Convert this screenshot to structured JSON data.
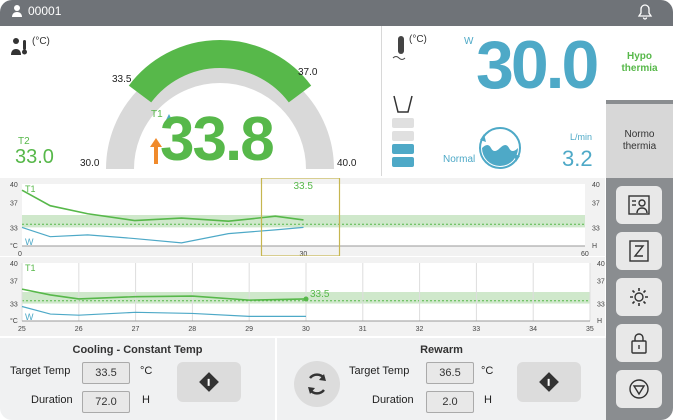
{
  "topbar": {
    "patient_id": "00001",
    "icons": [
      "person-icon",
      "bell-icon"
    ]
  },
  "left_panel": {
    "unit": "(°C)",
    "gauge": {
      "min_label": "30.0",
      "max_label": "40.0",
      "low_limit_label": "33.5",
      "high_limit_label": "37.0",
      "t1_label": "T1",
      "t1_value": "33.8",
      "t2_label": "T2",
      "t2_value": "33.0"
    }
  },
  "right_panel": {
    "unit": "(°C)",
    "w_label": "W",
    "w_value": "30.0",
    "flow_label": "Normal",
    "flow_unit": "L/min",
    "flow_value": "3.2"
  },
  "modes": {
    "hypothermia": "Hypo\nthermia",
    "normothermia": "Normo\nthermia"
  },
  "chart1": {
    "y_ticks_left": [
      "40",
      "37",
      "33",
      "°C"
    ],
    "y_ticks_right": [
      "40",
      "37",
      "33",
      "H"
    ],
    "x_ticks": [
      "0",
      "30",
      "60"
    ],
    "highlight_value": "33.5",
    "t1_label": "T1",
    "w_label": "W"
  },
  "chart2": {
    "y_ticks_left": [
      "40",
      "37",
      "33",
      "°C"
    ],
    "y_ticks_right": [
      "40",
      "37",
      "33",
      "H"
    ],
    "x_ticks": [
      "25",
      "26",
      "27",
      "28",
      "29",
      "30",
      "31",
      "32",
      "33",
      "34",
      "35"
    ],
    "marker_value": "33.5",
    "t1_label": "T1",
    "w_label": "W"
  },
  "chart_data": [
    {
      "type": "line",
      "x": [
        0,
        3,
        7,
        12,
        17,
        22,
        27,
        30
      ],
      "series": [
        {
          "name": "T1",
          "values": [
            39.0,
            36.5,
            35.2,
            34.1,
            34.5,
            34.0,
            34.8,
            34.2
          ]
        },
        {
          "name": "W",
          "values": [
            33.0,
            31.5,
            31.8,
            31.2,
            30.5,
            32.0,
            32.6,
            33.0
          ]
        }
      ],
      "xlim": [
        0,
        60
      ],
      "ylim": [
        30,
        40
      ],
      "target": 33.5,
      "band": [
        33,
        35
      ]
    },
    {
      "type": "line",
      "x": [
        25,
        25.5,
        26,
        27,
        28,
        29,
        30
      ],
      "series": [
        {
          "name": "T1",
          "values": [
            35.5,
            34.5,
            33.8,
            34.2,
            34.3,
            33.6,
            33.8
          ]
        },
        {
          "name": "W",
          "values": [
            32.5,
            31.2,
            31.0,
            31.5,
            31.3,
            30.8,
            30.8
          ]
        }
      ],
      "xlim": [
        25,
        35
      ],
      "ylim": [
        30,
        40
      ],
      "target": 33.5,
      "band": [
        33,
        35
      ]
    }
  ],
  "footer": {
    "left_title": "Cooling - Constant Temp",
    "target_label": "Target Temp",
    "target_value": "33.5",
    "target_unit": "°C",
    "duration_label": "Duration",
    "duration_value": "72.0",
    "duration_unit": "H",
    "right_title": "Rewarm",
    "rewarm_target_label": "Target Temp",
    "rewarm_target_value": "36.5",
    "rewarm_target_unit": "°C",
    "rewarm_duration_label": "Duration",
    "rewarm_duration_value": "2.0",
    "rewarm_duration_unit": "H"
  }
}
